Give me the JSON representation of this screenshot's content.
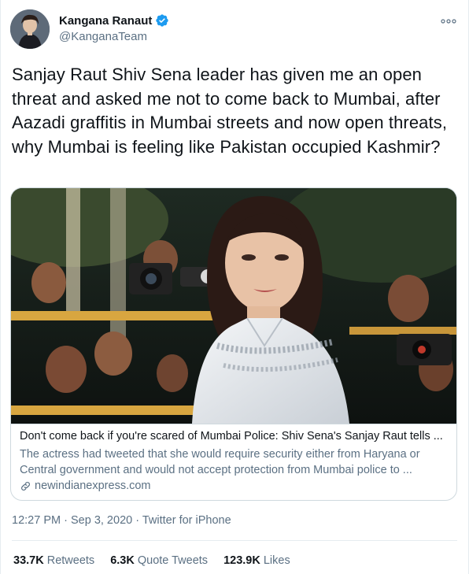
{
  "author": {
    "display_name": "Kangana Ranaut",
    "handle": "@KanganaTeam",
    "verified": true
  },
  "tweet": {
    "text": "Sanjay Raut Shiv Sena leader has given me an open threat and asked me not to come back to Mumbai, after Aazadi graffitis in Mumbai streets and now open threats, why Mumbai is feeling like Pakistan occupied Kashmir?"
  },
  "card": {
    "title": "Don't come back if you're scared of Mumbai Police: Shiv Sena's Sanjay Raut tells ...",
    "description": "The actress had tweeted that she would require security either from Haryana or Central government and would not accept protection from Mumbai police to ...",
    "domain": "newindianexpress.com",
    "image_icon": "photo"
  },
  "meta": {
    "time": "12:27 PM",
    "separator": "·",
    "date": "Sep 3, 2020",
    "source": "Twitter for iPhone"
  },
  "stats": {
    "retweets_count": "33.7K",
    "retweets_label": "Retweets",
    "quote_count": "6.3K",
    "quote_label": "Quote Tweets",
    "likes_count": "123.9K",
    "likes_label": "Likes"
  },
  "colors": {
    "verified": "#1d9bf0",
    "secondary_text": "#5b7083",
    "primary_text": "#0f1419",
    "border": "#cfd9de"
  },
  "icons": {
    "verified": "verified-badge-icon",
    "more": "more-dots-icon",
    "link": "link-icon"
  }
}
